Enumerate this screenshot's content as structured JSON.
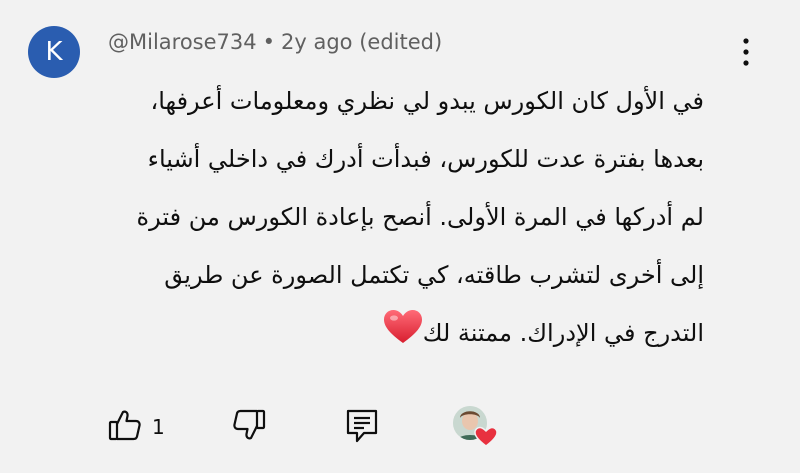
{
  "comment": {
    "avatar_letter": "K",
    "author": "@Milarose734",
    "separator": "•",
    "time": "2y ago (edited)",
    "lines": [
      "في الأول كان الكورس يبدو لي نظري ومعلومات أعرفها،",
      "بعدها بفترة عدت للكورس، فبدأت أدرك في داخلي أشياء",
      "لم أدركها في المرة الأولى. أنصح بإعادة الكورس من فترة",
      "إلى أخرى لتشرب طاقته، كي تكتمل الصورة عن طريق",
      "التدرج في الإدراك. ممتنة لك"
    ],
    "trailing_emoji": "heart-emoji"
  },
  "actions": {
    "like_count": "1"
  },
  "colors": {
    "avatar_bg": "#2a5db0",
    "heart": "#e8313f",
    "meta_text": "#606060"
  }
}
